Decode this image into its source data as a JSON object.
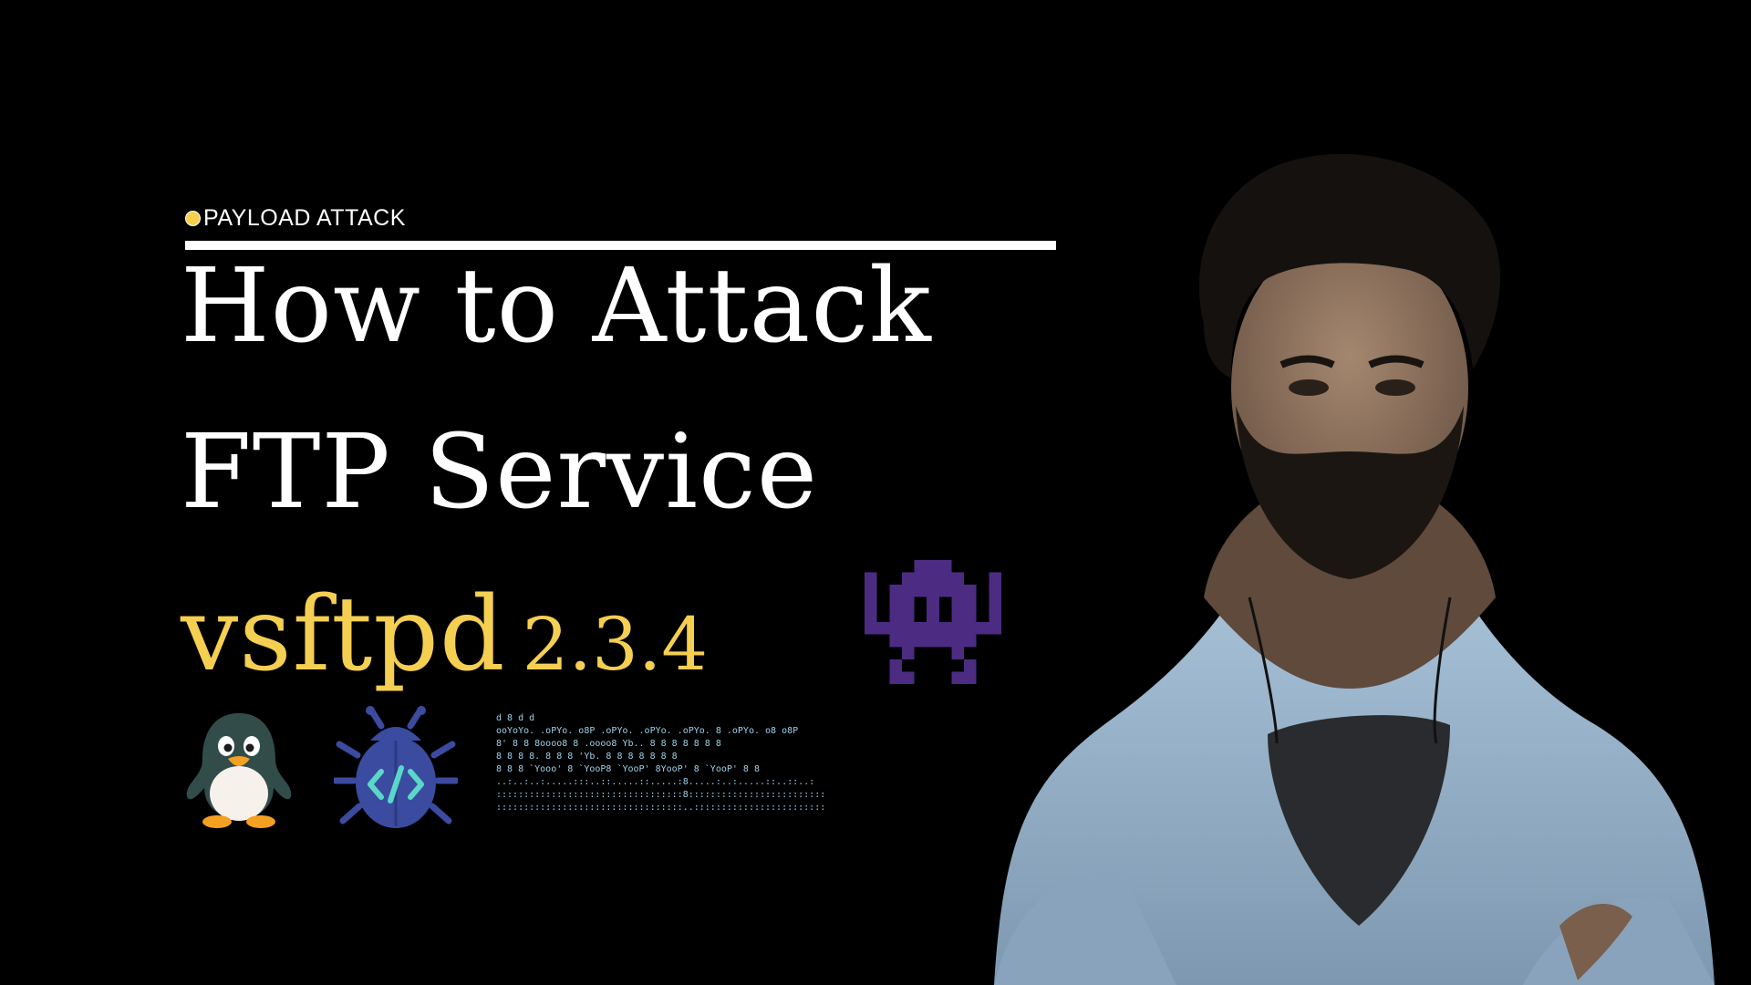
{
  "tag": {
    "label": "PAYLOAD ATTACK",
    "dot_color": "#f6d04d"
  },
  "title": {
    "line1": "How to Attack",
    "line2": "FTP Service"
  },
  "subtitle": {
    "name": "vsftpd",
    "version": "2.3.4",
    "color": "#f5cf52"
  },
  "icons": [
    "space-invader-icon",
    "linux-penguin-icon",
    "code-bug-icon",
    "metasploit-ascii-logo",
    "presenter-photo"
  ],
  "colors": {
    "background": "#000000",
    "title": "#ffffff",
    "invader": "#4b2c82",
    "bug": "#3b4ba0",
    "ascii": "#9fd0e8"
  }
}
